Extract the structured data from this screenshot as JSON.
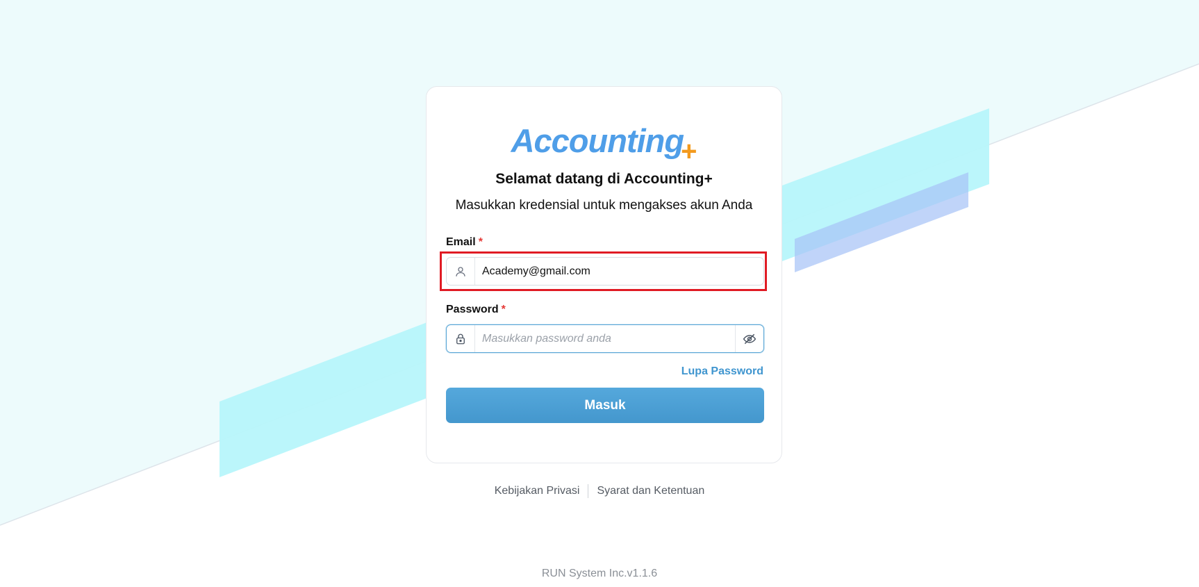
{
  "logo": {
    "text": "Accounting",
    "plus": "+"
  },
  "login": {
    "title": "Selamat datang di Accounting+",
    "subtitle": "Masukkan kredensial untuk mengakses akun Anda",
    "email_label": "Email",
    "email_value": "Academy@gmail.com",
    "required_mark": "*",
    "password_label": "Password",
    "password_placeholder": "Masukkan password anda",
    "forgot_label": "Lupa Password",
    "submit_label": "Masuk"
  },
  "icons": {
    "email": "user-icon",
    "password": "lock-icon",
    "toggle": "eye-off-icon"
  },
  "footer": {
    "privacy": "Kebijakan Privasi",
    "terms": "Syarat dan Ketentuan",
    "version": "RUN System Inc.v1.1.6"
  },
  "colors": {
    "brand_blue": "#4f9ee8",
    "brand_orange": "#f39a1e",
    "button": "#4a9dd4",
    "highlight": "#e01b24",
    "required": "#e53935"
  }
}
